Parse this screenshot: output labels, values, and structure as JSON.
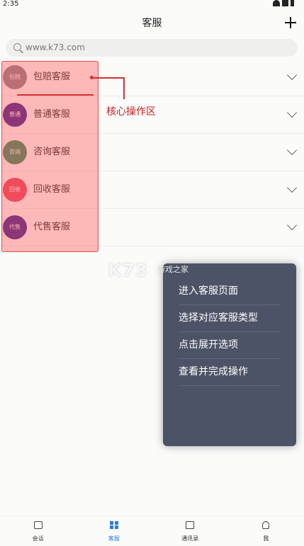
{
  "status_bar": {
    "time": "2:35"
  },
  "header": {
    "title": "客服"
  },
  "search": {
    "value": "www.k73.com"
  },
  "list": [
    {
      "avatar_text": "包赔",
      "avatar_color": "#8a7d86",
      "label": "包赔客服"
    },
    {
      "avatar_text": "普通",
      "avatar_color": "#3b1a8a",
      "label": "普通客服"
    },
    {
      "avatar_text": "咨询",
      "avatar_color": "#2f8a5a",
      "label": "咨询客服"
    },
    {
      "avatar_text": "回收",
      "avatar_color": "#e6405c",
      "label": "回收客服"
    },
    {
      "avatar_text": "代售",
      "avatar_color": "#3a1a8c",
      "label": "代售客服"
    }
  ],
  "annotation": {
    "label": "核心操作区"
  },
  "watermark": {
    "logo": "K73",
    "sub": "游戏之家"
  },
  "steps": [
    "进入客服页面",
    "选择对应客服类型",
    "点击展开选项",
    "查看并完成操作"
  ],
  "tabbar": [
    {
      "label": "会话",
      "icon": "chat-icon",
      "active": false
    },
    {
      "label": "客服",
      "icon": "grid-icon",
      "active": true
    },
    {
      "label": "通讯录",
      "icon": "contacts-icon",
      "active": false
    },
    {
      "label": "我",
      "icon": "person-icon",
      "active": false
    }
  ],
  "colors": {
    "accent": "#2a7be4",
    "highlight": "#ff5a5a",
    "panel": "#4d5366"
  }
}
